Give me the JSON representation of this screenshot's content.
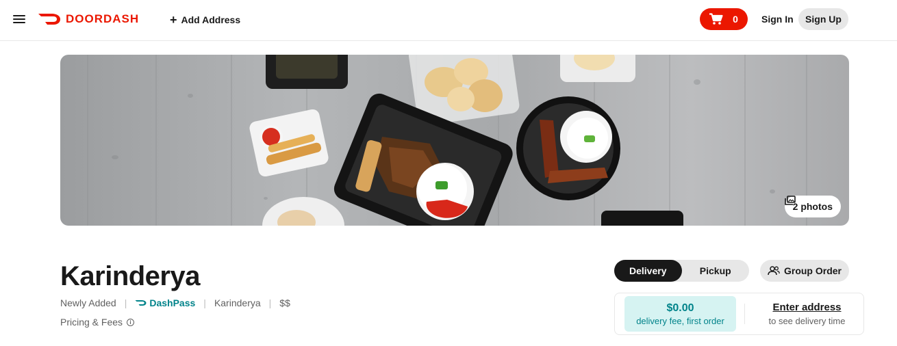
{
  "header": {
    "logo_text": "DOORDASH",
    "add_address_label": "Add Address",
    "cart_count": "0",
    "sign_in_label": "Sign In",
    "sign_up_label": "Sign Up"
  },
  "hero": {
    "photos_label": "2 photos"
  },
  "store": {
    "name": "Karinderya",
    "meta": [
      "Newly Added",
      "DashPass",
      "Karinderya",
      "$$"
    ],
    "pricing_label": "Pricing & Fees"
  },
  "order": {
    "modes": [
      "Delivery",
      "Pickup"
    ],
    "active_mode": "Delivery",
    "group_order_label": "Group Order",
    "fee_amount": "$0.00",
    "fee_sub": "delivery fee, first order",
    "address_link": "Enter address",
    "address_sub": "to see delivery time"
  },
  "colors": {
    "brand": "#eb1700",
    "dashpass": "#00838a",
    "fee_bg": "#d6f3f2"
  }
}
